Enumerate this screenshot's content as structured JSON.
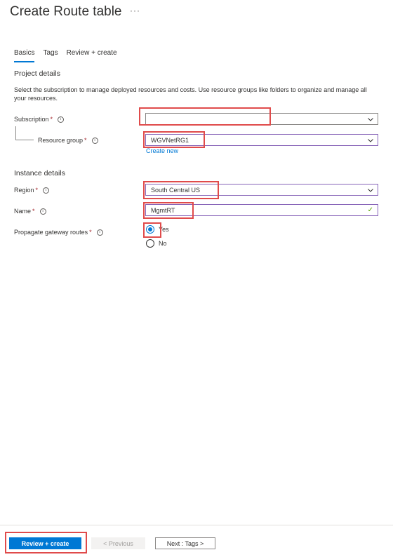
{
  "header": {
    "title": "Create Route table",
    "more_label": "···"
  },
  "tabs": [
    {
      "label": "Basics",
      "active": true
    },
    {
      "label": "Tags",
      "active": false
    },
    {
      "label": "Review + create",
      "active": false
    }
  ],
  "project": {
    "heading": "Project details",
    "description": "Select the subscription to manage deployed resources and costs. Use resource groups like folders to organize and manage all your resources.",
    "subscription": {
      "label": "Subscription",
      "required": "*",
      "value": ""
    },
    "resource_group": {
      "label": "Resource group",
      "required": "*",
      "value": "WGVNetRG1",
      "create_new": "Create new"
    }
  },
  "instance": {
    "heading": "Instance details",
    "region": {
      "label": "Region",
      "required": "*",
      "value": "South Central US"
    },
    "name": {
      "label": "Name",
      "required": "*",
      "value": "MgmtRT"
    },
    "propagate": {
      "label": "Propagate gateway routes",
      "required": "*",
      "options": [
        "Yes",
        "No"
      ],
      "selected": "Yes"
    }
  },
  "footer": {
    "review_create": "Review + create",
    "previous": "< Previous",
    "next": "Next : Tags >"
  },
  "colors": {
    "accent": "#0078d4",
    "required": "#a4262c",
    "highlight": "#e04b4b",
    "focus_border": "#8764b8",
    "valid": "#57a300"
  }
}
